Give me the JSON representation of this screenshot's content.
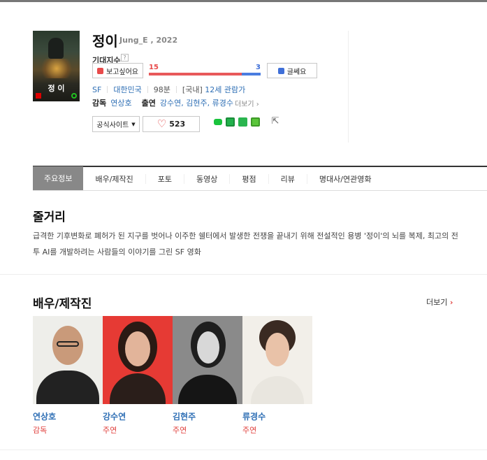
{
  "movie": {
    "title": "정이",
    "subtitle": "Jung_E , 2022",
    "poster_title": "정 이",
    "expectation_label": "기대지수",
    "help_mark": "?",
    "want_button": "보고싶어요",
    "nope_button": "글쎄요",
    "want_count": "15",
    "nope_count": "3",
    "want_ratio": 0.833,
    "genre": "SF",
    "country": "대한민국",
    "runtime": "98분",
    "rating_prefix": "[국내]",
    "rating": "12세 관람가",
    "director_label": "감독",
    "director": "연상호",
    "cast_label": "출연",
    "cast_names": "강수연, 김현주, 류경수",
    "cast_more": "더보기",
    "official_site": "공식사이트",
    "likes": "523"
  },
  "tabs": [
    {
      "label": "주요정보"
    },
    {
      "label": "배우/제작진"
    },
    {
      "label": "포토"
    },
    {
      "label": "동영상"
    },
    {
      "label": "평점"
    },
    {
      "label": "리뷰"
    },
    {
      "label": "명대사/연관영화"
    }
  ],
  "synopsis": {
    "title": "줄거리",
    "text": "급격한 기후변화로 폐허가 된 지구를 벗어나 이주한 쉘터에서 발생한 전쟁을 끝내기 위해 전설적인 용병 '정이'의 뇌를 복제, 최고의 전투 AI를 개발하려는 사람들의 이야기를 그린 SF 영화"
  },
  "crew": {
    "title": "배우/제작진",
    "more": "더보기",
    "people": [
      {
        "name": "연상호",
        "role": "감독"
      },
      {
        "name": "강수연",
        "role": "주연"
      },
      {
        "name": "김현주",
        "role": "주연"
      },
      {
        "name": "류경수",
        "role": "주연"
      }
    ]
  },
  "colors": {
    "accent_red": "#e0413e",
    "link_blue": "#2f6fb5",
    "bar_blue": "#4a7de0"
  }
}
